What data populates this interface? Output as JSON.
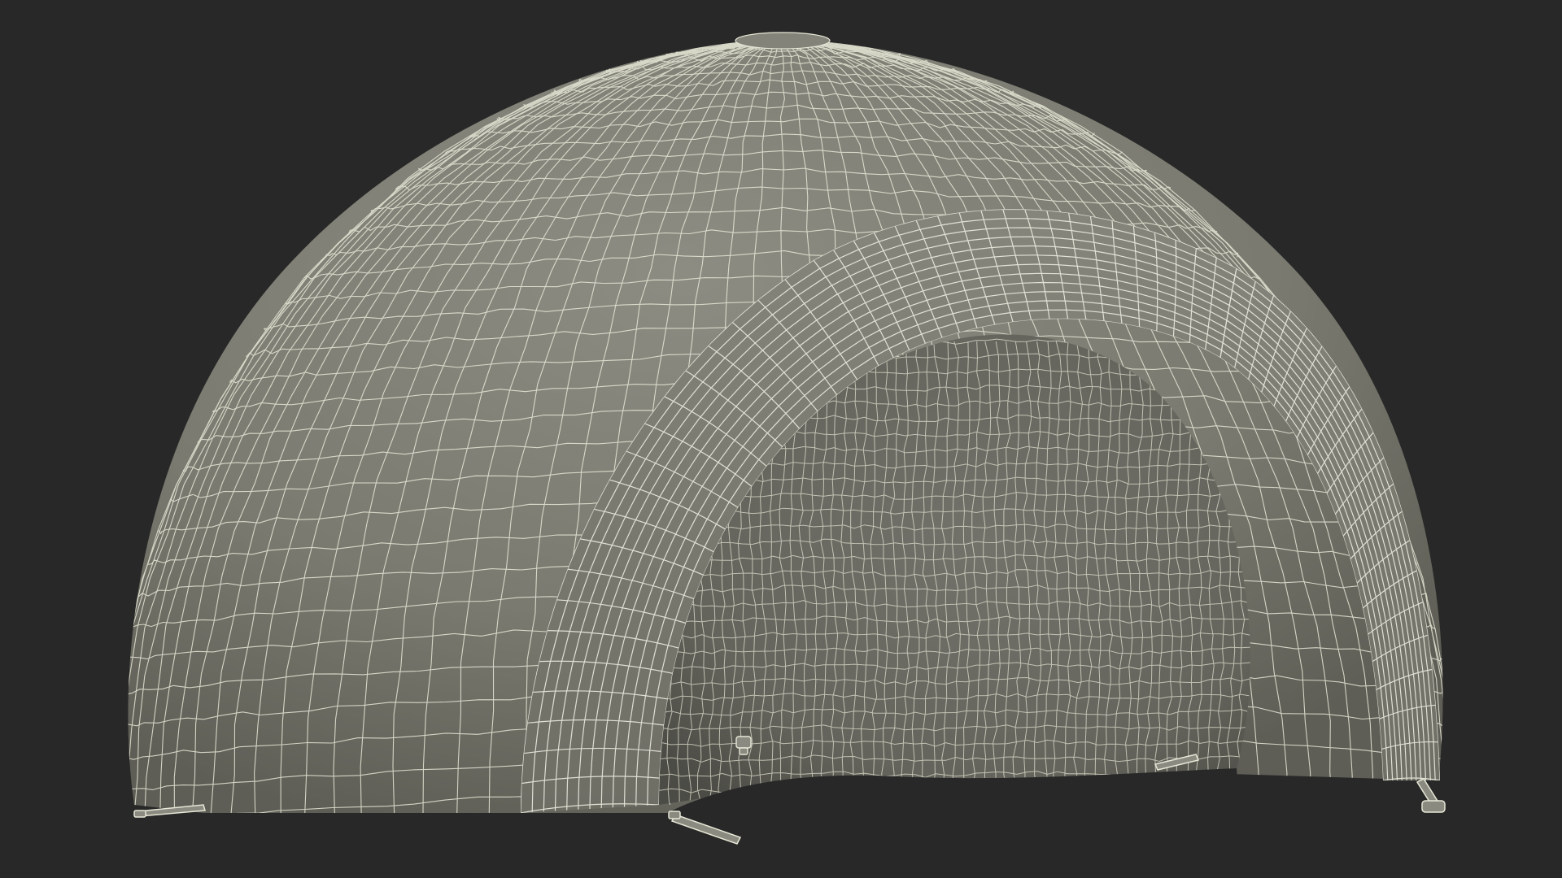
{
  "scene": {
    "subject": "inflatable-dome-tent",
    "render_mode": "wireframe-on-shaded",
    "colors": {
      "background": "#282828",
      "shell": "#7a7a70",
      "shell_light": "#8a8a80",
      "shell_dark": "#5f5f57",
      "interior": "#6c6c64",
      "interior_shadow": "#4a4a44",
      "wire": "#e8e8d8",
      "ground_gap": "#282828"
    },
    "icons": [
      "zipper-pull-icon",
      "valve-icon"
    ]
  }
}
